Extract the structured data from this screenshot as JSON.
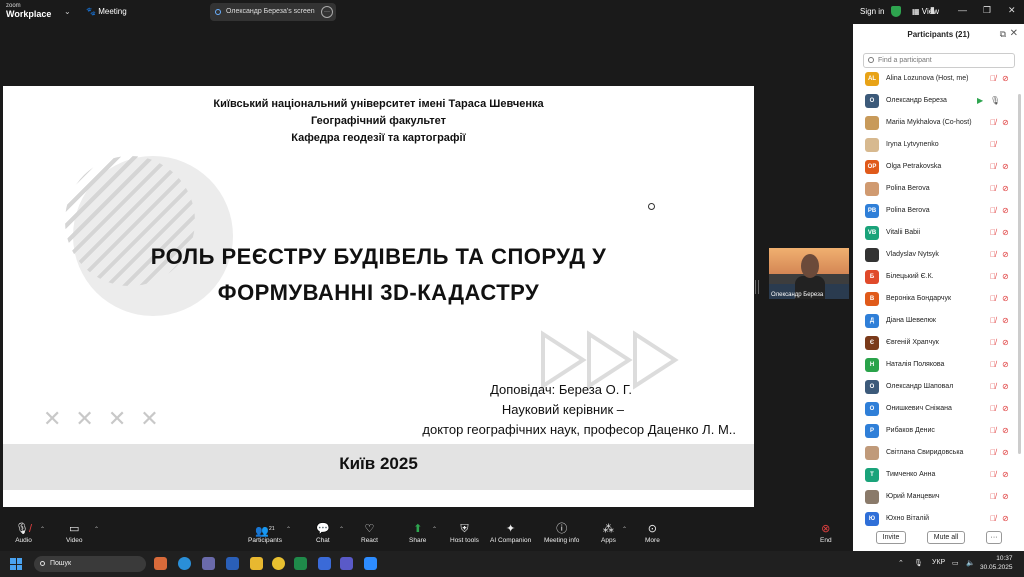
{
  "topbar": {
    "logo_top": "zoom",
    "logo_bottom": "Workplace",
    "meeting_label": "Meeting",
    "share_label": "Олександр Береза's screen",
    "signin_label": "Sign in",
    "view_label": "View"
  },
  "slide": {
    "header_lines": [
      "Київський національний університет імені Тараса Шевченка",
      "Географічний факультет",
      "Кафедра геодезії та картографії"
    ],
    "title_lines": [
      "РОЛЬ РЕЄСТРУ БУДІВЕЛЬ ТА СПОРУД У",
      "ФОРМУВАННІ 3D-КАДАСТРУ"
    ],
    "speaker": "Доповідач: Береза О. Г.",
    "supervisor_label": "Науковий керівник –",
    "supervisor": "доктор географічних наук, професор Даценко Л. М..",
    "footer": "Київ 2025"
  },
  "video_thumb": {
    "name": "Олександр Береза"
  },
  "participants": {
    "title": "Participants (21)",
    "search_placeholder": "Find a participant",
    "list": [
      {
        "initials": "AL",
        "color": "#e8a317",
        "name": "Alina Lozunova (Host, me)",
        "mic": "muted",
        "cam": "off"
      },
      {
        "initials": "О",
        "color": "#3c5a7a",
        "name": "Олександр Береза",
        "mic": "on",
        "cam": "on"
      },
      {
        "initials": "",
        "color": "#c89a5a",
        "name": "Mariia Mykhalova (Co-host)",
        "mic": "muted",
        "cam": "off"
      },
      {
        "initials": "",
        "color": "#d7b98f",
        "name": "Iryna Lytvynenko",
        "mic": "muted",
        "cam": ""
      },
      {
        "initials": "OP",
        "color": "#e05a1a",
        "name": "Olga Petrakovska",
        "mic": "muted",
        "cam": "off"
      },
      {
        "initials": "",
        "color": "#d09a70",
        "name": "Polina Berova",
        "mic": "muted",
        "cam": "off"
      },
      {
        "initials": "PB",
        "color": "#2f7fd8",
        "name": "Polina Berova",
        "mic": "muted",
        "cam": "off"
      },
      {
        "initials": "VB",
        "color": "#1aa37a",
        "name": "Vitalii Babii",
        "mic": "muted",
        "cam": "off"
      },
      {
        "initials": "",
        "color": "#333333",
        "name": "Vladyslav Nytsyk",
        "mic": "muted",
        "cam": "off"
      },
      {
        "initials": "Б",
        "color": "#e04a2a",
        "name": "Білецький Є.К.",
        "mic": "muted",
        "cam": "off"
      },
      {
        "initials": "В",
        "color": "#e05a1a",
        "name": "Вероніка Бондарчук",
        "mic": "muted",
        "cam": "off"
      },
      {
        "initials": "Д",
        "color": "#2f7fd8",
        "name": "Діана Шевелюк",
        "mic": "muted",
        "cam": "off"
      },
      {
        "initials": "Є",
        "color": "#7a3a1a",
        "name": "Євгеній Храпчук",
        "mic": "muted",
        "cam": "off"
      },
      {
        "initials": "Н",
        "color": "#2aa34a",
        "name": "Наталія Полякова",
        "mic": "muted",
        "cam": "off"
      },
      {
        "initials": "О",
        "color": "#3c5a7a",
        "name": "Олександр Шаповал",
        "mic": "muted",
        "cam": "off"
      },
      {
        "initials": "О",
        "color": "#2f7fd8",
        "name": "Онишкевич Сніжана",
        "mic": "muted",
        "cam": "off"
      },
      {
        "initials": "Р",
        "color": "#2f7fd8",
        "name": "Рибаков Денис",
        "mic": "muted",
        "cam": "off"
      },
      {
        "initials": "",
        "color": "#c09a7a",
        "name": "Світлана Свиридовська",
        "mic": "muted",
        "cam": "off"
      },
      {
        "initials": "Т",
        "color": "#1aa37a",
        "name": "Тимченко Анна",
        "mic": "muted",
        "cam": "off"
      },
      {
        "initials": "",
        "color": "#8a7a6a",
        "name": "Юрий Манцевич",
        "mic": "muted",
        "cam": "off"
      },
      {
        "initials": "Ю",
        "color": "#2f6fd8",
        "name": "Юхно Віталій",
        "mic": "muted",
        "cam": "off"
      }
    ],
    "invite_label": "Invite",
    "mute_all_label": "Mute all",
    "more_label": "···"
  },
  "toolbar": {
    "audio": "Audio",
    "video": "Video",
    "participants": "Participants",
    "participants_count": "21",
    "chat": "Chat",
    "react": "React",
    "share": "Share",
    "host_tools": "Host tools",
    "ai_companion": "AI Companion",
    "meeting_info": "Meeting info",
    "apps": "Apps",
    "more": "More",
    "end": "End"
  },
  "taskbar": {
    "search_label": "Пошук",
    "lang": "УКР",
    "time": "10:37",
    "date": "30.05.2025"
  }
}
